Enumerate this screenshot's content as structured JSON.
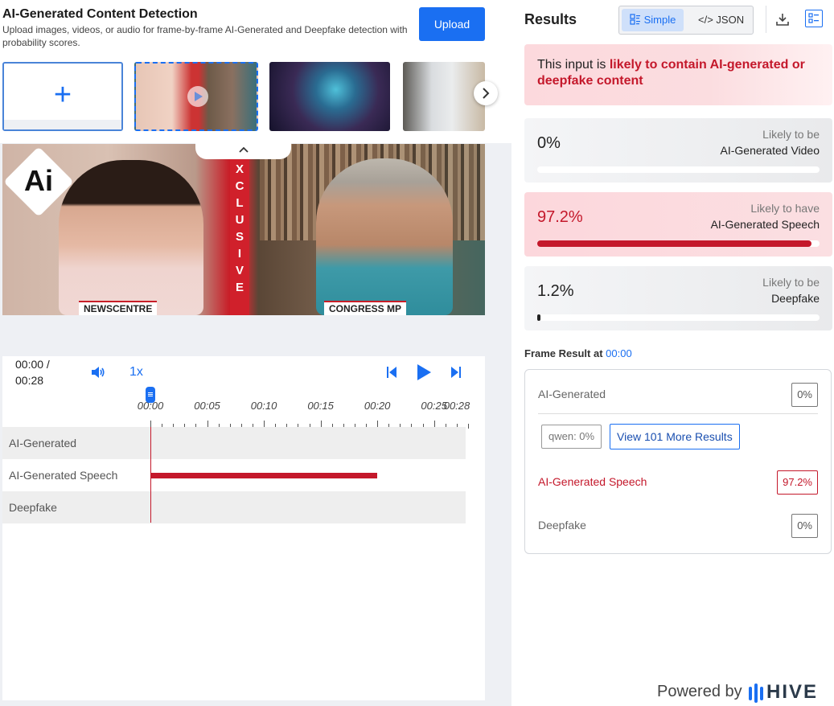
{
  "header": {
    "title": "AI-Generated Content Detection",
    "subtitle": "Upload images, videos, or audio for frame-by-frame AI-Generated and Deepfake detection with probability scores.",
    "upload_label": "Upload"
  },
  "thumbnails": {
    "add_symbol": "+",
    "items": [
      "newsroom-video",
      "cyberpunk-image",
      "interior-room-image"
    ]
  },
  "video": {
    "overlay_text": "EXCLUSIVE",
    "left_tag": "NEWSCENTRE",
    "right_tag": "CONGRESS MP",
    "badge": "Ai"
  },
  "player": {
    "time_current": "00:00 /",
    "time_total": "00:28",
    "speed": "1x"
  },
  "timeline": {
    "ticks": [
      "00:00",
      "00:05",
      "00:10",
      "00:15",
      "00:20",
      "00:25",
      "00:28"
    ],
    "duration_seconds": 28,
    "tracks": [
      {
        "label": "AI-Generated",
        "segment": null
      },
      {
        "label": "AI-Generated Speech",
        "segment": [
          0,
          20
        ]
      },
      {
        "label": "Deepfake",
        "segment": null
      }
    ]
  },
  "results": {
    "title": "Results",
    "view_simple": "Simple",
    "view_json": "</> JSON",
    "verdict_prefix": "This input is ",
    "verdict_highlight": "likely to contain AI-generated or deepfake content",
    "cards": [
      {
        "value": "0%",
        "line1": "Likely to be",
        "line2": "AI-Generated Video",
        "fraction": 0,
        "alert": false
      },
      {
        "value": "97.2%",
        "line1": "Likely to have",
        "line2": "AI-Generated Speech",
        "fraction": 0.972,
        "alert": true
      },
      {
        "value": "1.2%",
        "line1": "Likely to be",
        "line2": "Deepfake",
        "fraction": 0.012,
        "alert": false
      }
    ],
    "frame_label": "Frame Result at",
    "frame_time": "00:00",
    "frame_rows": {
      "ai_generated_label": "AI-Generated",
      "ai_generated_value": "0%",
      "qwen_chip": "qwen: 0%",
      "more_results": "View 101 More Results",
      "speech_label": "AI-Generated Speech",
      "speech_value": "97.2%",
      "deepfake_label": "Deepfake",
      "deepfake_value": "0%"
    },
    "powered_by": "Powered by",
    "brand": "HIVE"
  },
  "colors": {
    "accent": "#1a6ff2",
    "alert": "#c4182b"
  }
}
